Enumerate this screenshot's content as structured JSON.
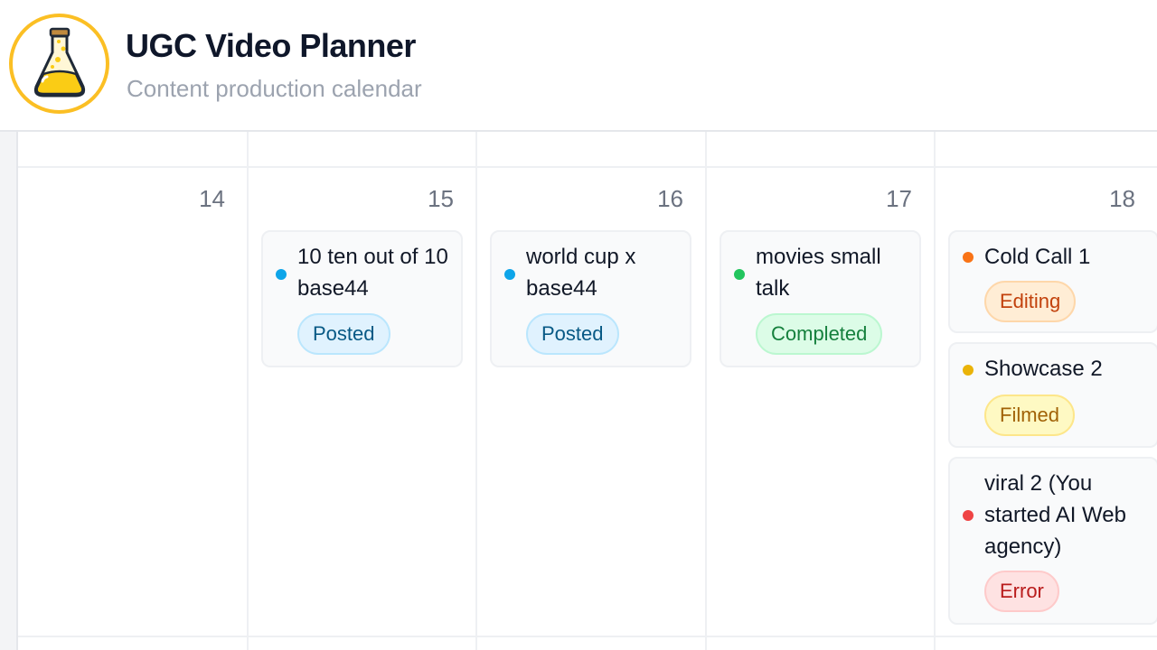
{
  "app": {
    "title": "UGC Video Planner",
    "subtitle": "Content production calendar",
    "logo_icon": "flask-icon"
  },
  "colors": {
    "posted": "#0ea5e9",
    "completed": "#22c55e",
    "editing": "#f97316",
    "filmed": "#eab308",
    "error": "#ef4444",
    "logo_ring": "#fbbf24"
  },
  "calendar": {
    "days": [
      {
        "number": "14",
        "events": []
      },
      {
        "number": "15",
        "events": [
          {
            "title": "10 ten out of 10 base44",
            "status": "Posted"
          }
        ]
      },
      {
        "number": "16",
        "events": [
          {
            "title": "world cup x base44",
            "status": "Posted"
          }
        ]
      },
      {
        "number": "17",
        "events": [
          {
            "title": "movies small talk",
            "status": "Completed"
          }
        ]
      },
      {
        "number": "18",
        "events": [
          {
            "title": "Cold Call 1",
            "status": "Editing"
          },
          {
            "title": "Showcase 2",
            "status": "Filmed"
          },
          {
            "title": "viral 2 (You started AI Web agency)",
            "status": "Error"
          }
        ]
      }
    ]
  }
}
